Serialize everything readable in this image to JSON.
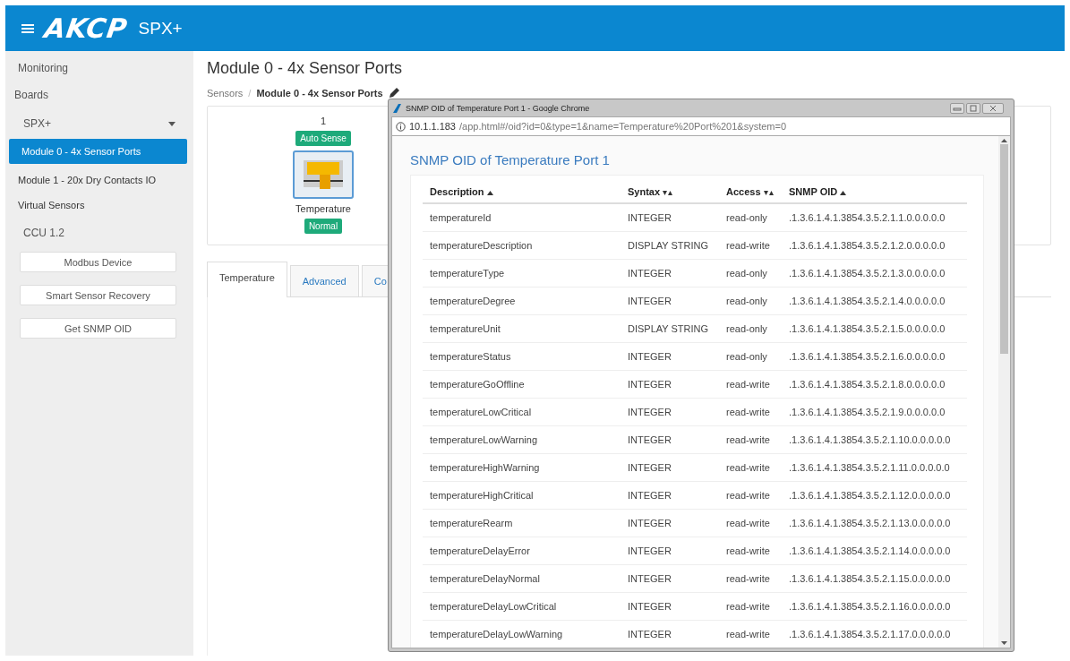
{
  "header": {
    "logo": "AKCP",
    "product": "SPX+"
  },
  "sidebar": {
    "items": [
      {
        "kind": "heading",
        "label": "Monitoring"
      },
      {
        "kind": "heading",
        "label": "Boards"
      },
      {
        "kind": "dropdown",
        "label": "SPX+",
        "expanded": true
      },
      {
        "kind": "module",
        "label": "Module 0 - 4x Sensor Ports",
        "selected": true
      },
      {
        "kind": "module",
        "label": "Module 1 - 20x Dry Contacts IO",
        "selected": false
      },
      {
        "kind": "module",
        "label": "Virtual Sensors",
        "selected": false
      },
      {
        "kind": "heading",
        "label": "CCU 1.2"
      }
    ],
    "buttons": [
      "Modbus Device",
      "Smart Sensor Recovery",
      "Get SNMP OID"
    ]
  },
  "page": {
    "title": "Module 0 - 4x Sensor Ports",
    "breadcrumb": [
      "Sensors",
      "Module 0 - 4x Sensor Ports"
    ],
    "breadcrumb_separator": "/",
    "port": {
      "number": "1",
      "mode": "Auto Sense",
      "name": "Temperature",
      "status": "Normal"
    },
    "tabs": [
      {
        "label": "Temperature",
        "selected": true
      },
      {
        "label": "Advanced",
        "selected": false
      },
      {
        "label": "Co",
        "selected": false
      }
    ]
  },
  "popup": {
    "window_title": "SNMP OID of Temperature Port 1 - Google Chrome",
    "url_host": "10.1.1.183",
    "url_path": "/app.html#/oid?id=0&type=1&name=Temperature%20Port%201&system=0",
    "heading": "SNMP OID of Temperature Port 1",
    "columns": [
      {
        "label": "Description",
        "sorted": true
      },
      {
        "label": "Syntax",
        "sorted": false
      },
      {
        "label": "Access",
        "sorted": false
      },
      {
        "label": "SNMP OID",
        "sorted": true
      }
    ],
    "rows": [
      [
        "temperatureId",
        "INTEGER",
        "read-only",
        ".1.3.6.1.4.1.3854.3.5.2.1.1.0.0.0.0.0"
      ],
      [
        "temperatureDescription",
        "DISPLAY STRING",
        "read-write",
        ".1.3.6.1.4.1.3854.3.5.2.1.2.0.0.0.0.0"
      ],
      [
        "temperatureType",
        "INTEGER",
        "read-only",
        ".1.3.6.1.4.1.3854.3.5.2.1.3.0.0.0.0.0"
      ],
      [
        "temperatureDegree",
        "INTEGER",
        "read-only",
        ".1.3.6.1.4.1.3854.3.5.2.1.4.0.0.0.0.0"
      ],
      [
        "temperatureUnit",
        "DISPLAY STRING",
        "read-only",
        ".1.3.6.1.4.1.3854.3.5.2.1.5.0.0.0.0.0"
      ],
      [
        "temperatureStatus",
        "INTEGER",
        "read-only",
        ".1.3.6.1.4.1.3854.3.5.2.1.6.0.0.0.0.0"
      ],
      [
        "temperatureGoOffline",
        "INTEGER",
        "read-write",
        ".1.3.6.1.4.1.3854.3.5.2.1.8.0.0.0.0.0"
      ],
      [
        "temperatureLowCritical",
        "INTEGER",
        "read-write",
        ".1.3.6.1.4.1.3854.3.5.2.1.9.0.0.0.0.0"
      ],
      [
        "temperatureLowWarning",
        "INTEGER",
        "read-write",
        ".1.3.6.1.4.1.3854.3.5.2.1.10.0.0.0.0.0"
      ],
      [
        "temperatureHighWarning",
        "INTEGER",
        "read-write",
        ".1.3.6.1.4.1.3854.3.5.2.1.11.0.0.0.0.0"
      ],
      [
        "temperatureHighCritical",
        "INTEGER",
        "read-write",
        ".1.3.6.1.4.1.3854.3.5.2.1.12.0.0.0.0.0"
      ],
      [
        "temperatureRearm",
        "INTEGER",
        "read-write",
        ".1.3.6.1.4.1.3854.3.5.2.1.13.0.0.0.0.0"
      ],
      [
        "temperatureDelayError",
        "INTEGER",
        "read-write",
        ".1.3.6.1.4.1.3854.3.5.2.1.14.0.0.0.0.0"
      ],
      [
        "temperatureDelayNormal",
        "INTEGER",
        "read-write",
        ".1.3.6.1.4.1.3854.3.5.2.1.15.0.0.0.0.0"
      ],
      [
        "temperatureDelayLowCritical",
        "INTEGER",
        "read-write",
        ".1.3.6.1.4.1.3854.3.5.2.1.16.0.0.0.0.0"
      ],
      [
        "temperatureDelayLowWarning",
        "INTEGER",
        "read-write",
        ".1.3.6.1.4.1.3854.3.5.2.1.17.0.0.0.0.0"
      ]
    ]
  }
}
